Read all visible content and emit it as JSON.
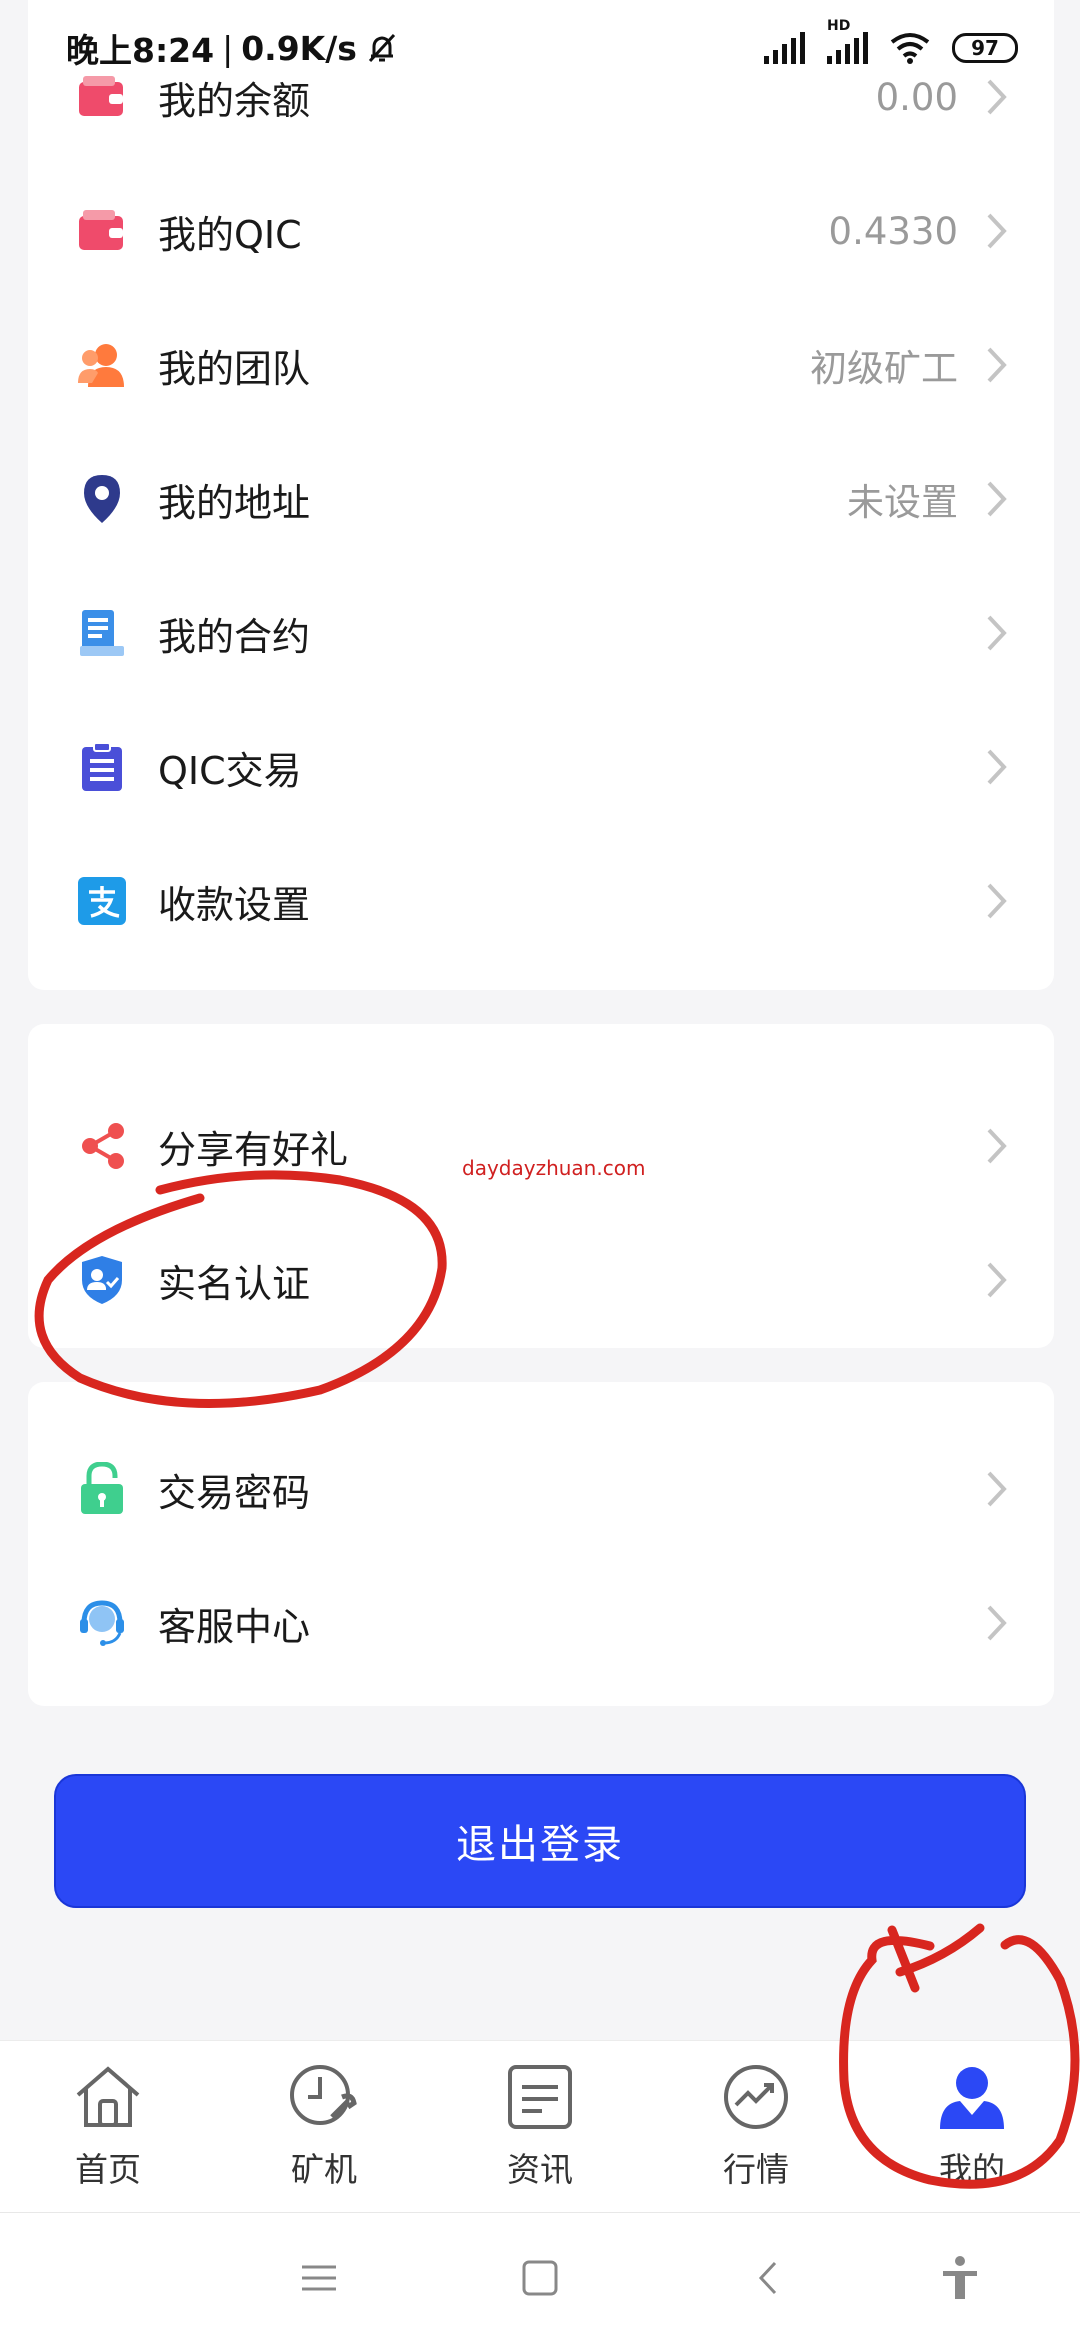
{
  "status_bar": {
    "time": "晚上8:24",
    "speed": "0.9K/s",
    "network_badge": "HD",
    "battery": "97"
  },
  "menu_section_1": [
    {
      "label": "我的余额",
      "value": "0.00",
      "icon": "wallet-icon",
      "color": "#ef4b6b"
    },
    {
      "label": "我的QIC",
      "value": "0.4330",
      "icon": "wallet-icon",
      "color": "#ef4b6b"
    },
    {
      "label": "我的团队",
      "value": "初级矿工",
      "icon": "team-icon",
      "color": "#ff7a3d"
    },
    {
      "label": "我的地址",
      "value": "未设置",
      "icon": "location-pin-icon",
      "color": "#2e3a8c"
    },
    {
      "label": "我的合约",
      "value": "",
      "icon": "contract-icon",
      "color": "#3b8fe8"
    },
    {
      "label": "QIC交易",
      "value": "",
      "icon": "clipboard-list-icon",
      "color": "#4a4fd8"
    },
    {
      "label": "收款设置",
      "value": "",
      "icon": "alipay-icon",
      "color": "#1e9be8"
    }
  ],
  "menu_section_2": [
    {
      "label": "分享有好礼",
      "icon": "share-icon",
      "color": "#ef5050"
    },
    {
      "label": "实名认证",
      "icon": "verified-user-icon",
      "color": "#2f7fe6"
    }
  ],
  "menu_section_3": [
    {
      "label": "交易密码",
      "icon": "unlock-icon",
      "color": "#3fcf8e"
    },
    {
      "label": "客服中心",
      "icon": "headset-icon",
      "color": "#2c8fe8"
    }
  ],
  "logout_label": "退出登录",
  "watermark": "daydayzhuan.com",
  "tabs": [
    {
      "label": "首页",
      "icon": "home-icon",
      "active": false
    },
    {
      "label": "矿机",
      "icon": "miner-clock-icon",
      "active": false
    },
    {
      "label": "资讯",
      "icon": "news-icon",
      "active": false
    },
    {
      "label": "行情",
      "icon": "trend-icon",
      "active": false
    },
    {
      "label": "我的",
      "icon": "profile-icon",
      "active": true
    }
  ],
  "colors": {
    "accent": "#2b48f5",
    "annotation": "#d8261f",
    "chevron": "#c4c4c4"
  }
}
